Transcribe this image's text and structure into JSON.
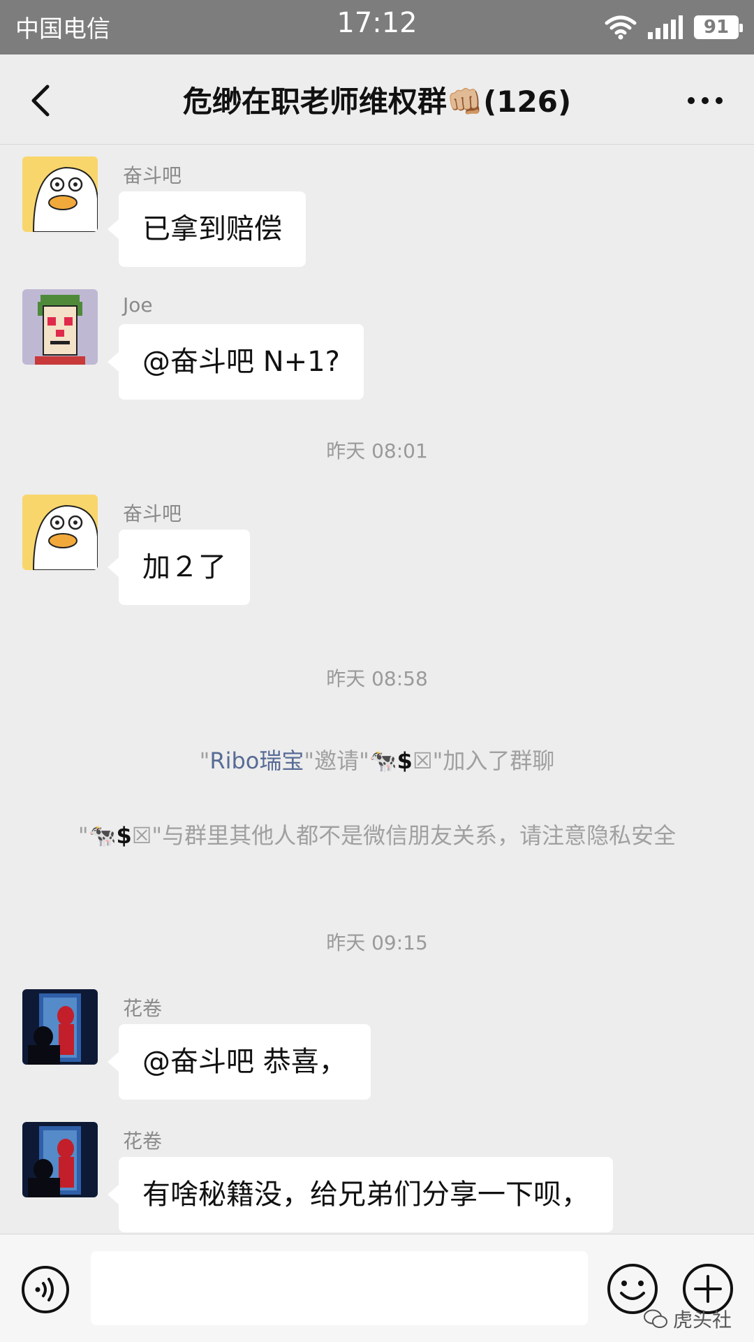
{
  "status_bar": {
    "carrier": "中国电信",
    "time": "17:12",
    "battery": "91"
  },
  "header": {
    "title": "危缈在职老师维权群👊🏼(126)"
  },
  "messages": [
    {
      "sender": "奋斗吧",
      "text": "已拿到赔偿"
    },
    {
      "sender": "Joe",
      "text": "@奋斗吧  N+1?"
    },
    {
      "sender": "奋斗吧",
      "text": "加２了"
    },
    {
      "sender": "花卷",
      "text": "@奋斗吧  恭喜，"
    },
    {
      "sender": "花卷",
      "text": "有啥秘籍没，给兄弟们分享一下呗，"
    }
  ],
  "timestamps": [
    "昨天 08:01",
    "昨天 08:58",
    "昨天 09:15"
  ],
  "system": {
    "invite": {
      "q1": "\"",
      "inviter": "Ribo瑞宝",
      "mid": "\"邀请\"",
      "cow": "🐄",
      "dollar": "$",
      "box": "☒",
      "end": "\"加入了群聊"
    },
    "privacy": {
      "q1": "\"",
      "cow": "🐄",
      "dollar": "$",
      "box": "☒",
      "rest": "\"与群里其他人都不是微信朋友关系，请注意隐私安全"
    }
  },
  "watermark": "虎头社",
  "colors": {
    "background": "#ededed",
    "status_bar": "#7d7d7d",
    "link": "#576b95",
    "bubble": "#ffffff"
  },
  "icons": {
    "back": "chevron-left-icon",
    "more": "more-dots-icon",
    "voice": "voice-icon",
    "emoji": "emoji-icon",
    "plus": "plus-icon"
  }
}
